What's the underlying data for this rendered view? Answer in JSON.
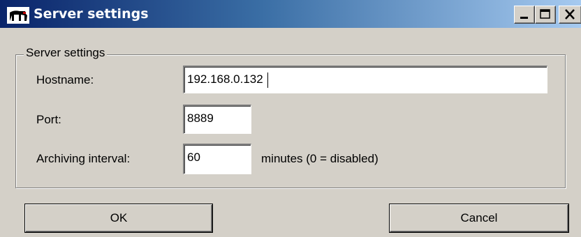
{
  "window": {
    "title": "Server settings",
    "controls": [
      "minimize-icon",
      "maximize-icon",
      "close-icon"
    ]
  },
  "group": {
    "legend": "Server settings"
  },
  "fields": {
    "hostname": {
      "label": "Hostname:",
      "value": "192.168.0.132"
    },
    "port": {
      "label": "Port:",
      "value": "8889"
    },
    "archiving": {
      "label": "Archiving interval:",
      "value": "60",
      "hint": "minutes  (0 = disabled)"
    }
  },
  "buttons": {
    "ok": "OK",
    "cancel": "Cancel"
  },
  "colors": {
    "titlebar_start": "#0a246a",
    "titlebar_end": "#a6caf0",
    "face": "#d4d0c8"
  }
}
